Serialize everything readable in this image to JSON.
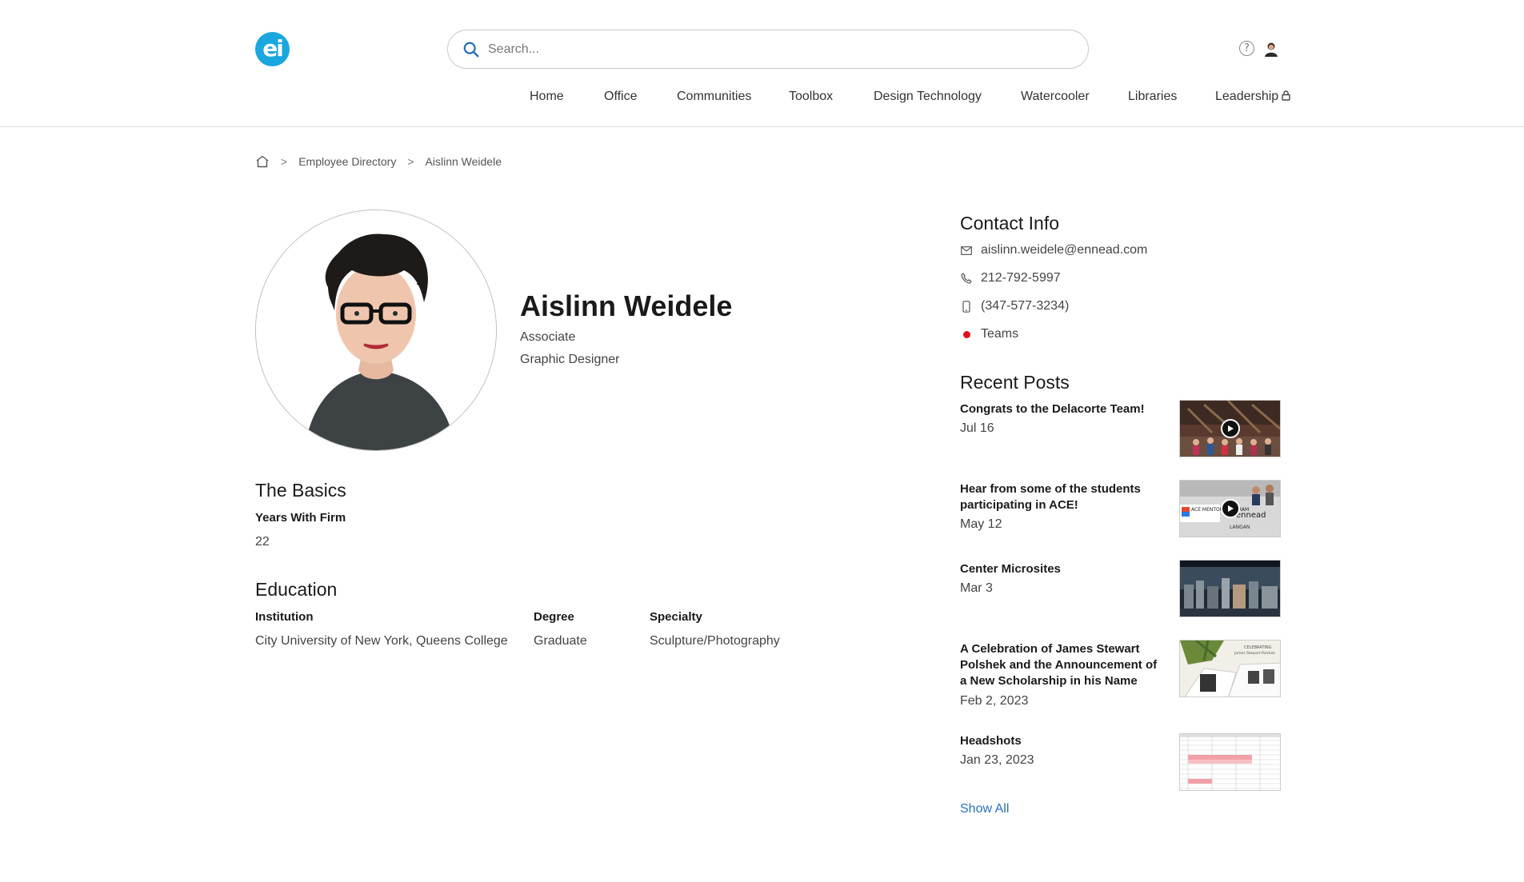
{
  "header": {
    "logo_text": "ei",
    "search_placeholder": "Search...",
    "help_glyph": "?",
    "icons": [
      "search-icon",
      "help-icon",
      "user-avatar-icon",
      "lock-icon"
    ],
    "nav": [
      "Home",
      "Office",
      "Communities",
      "Toolbox",
      "Design Technology",
      "Watercooler",
      "Libraries",
      "Leadership"
    ]
  },
  "breadcrumb": {
    "home_icon": "home-icon",
    "separator": ">",
    "items": [
      "Employee Directory",
      "Aislinn Weidele"
    ]
  },
  "profile": {
    "name": "Aislinn Weidele",
    "title": "Associate",
    "role": "Graphic Designer"
  },
  "basics": {
    "heading": "The Basics",
    "years_label": "Years With Firm",
    "years_value": "22"
  },
  "education": {
    "heading": "Education",
    "headers": [
      "Institution",
      "Degree",
      "Specialty"
    ],
    "row": [
      "City University of New York, Queens College",
      "Graduate",
      "Sculpture/Photography"
    ]
  },
  "contact": {
    "heading": "Contact Info",
    "email": "aislinn.weidele@ennead.com",
    "phone": "212-792-5997",
    "mobile": "(347-577-3234)",
    "teams": "Teams",
    "teams_status_color": "#e0101a"
  },
  "posts": {
    "heading": "Recent Posts",
    "items": [
      {
        "title": "Congrats to the Delacorte Team!",
        "date": "Jul 16"
      },
      {
        "title": "Hear from some of the students participating in ACE!",
        "date": "May 12"
      },
      {
        "title": "Center Microsites",
        "date": "Mar 3"
      },
      {
        "title": "A Celebration of James Stewart Polshek and the Announcement of a New Scholarship in his Name",
        "date": "Feb 2, 2023"
      },
      {
        "title": "Headshots",
        "date": "Jan 23, 2023"
      }
    ],
    "show_all": "Show All"
  },
  "thumbnail_text": {
    "ace_program": "ACE MENTOR PROGRAM",
    "ace_ennead": "ennead",
    "ace_langan": "LANGAN",
    "polshek_1": "CELEBRATING",
    "polshek_2": "James Stewart Polshek"
  },
  "colors": {
    "accent": "#1aa7e0",
    "link": "#2a72b8",
    "status_red": "#e0101a"
  }
}
